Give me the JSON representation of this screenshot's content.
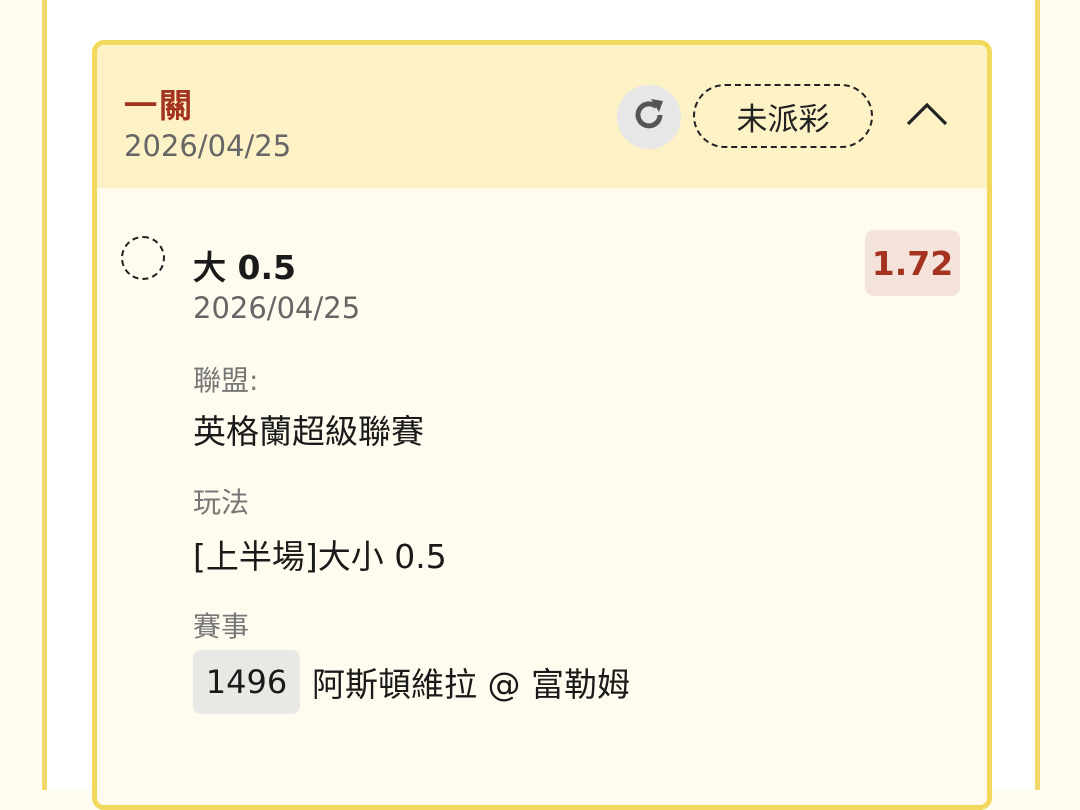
{
  "header": {
    "bet_type": "一關",
    "date": "2026/04/25",
    "status": "未派彩",
    "refresh_icon": "refresh-icon",
    "collapse_icon": "chevron-up-icon"
  },
  "selection": {
    "name": "大 0.5",
    "date": "2026/04/25",
    "odds": "1.72",
    "league_label": "聯盟:",
    "league_value": "英格蘭超級聯賽",
    "market_label": "玩法",
    "market_value": "[上半場]大小 0.5",
    "event_label": "賽事",
    "event_id": "1496",
    "event_teams": "阿斯頓維拉 @ 富勒姆"
  },
  "colors": {
    "accent_red": "#a3321e",
    "border_yellow": "#f2d85c",
    "header_bg": "#fdf1c6"
  }
}
